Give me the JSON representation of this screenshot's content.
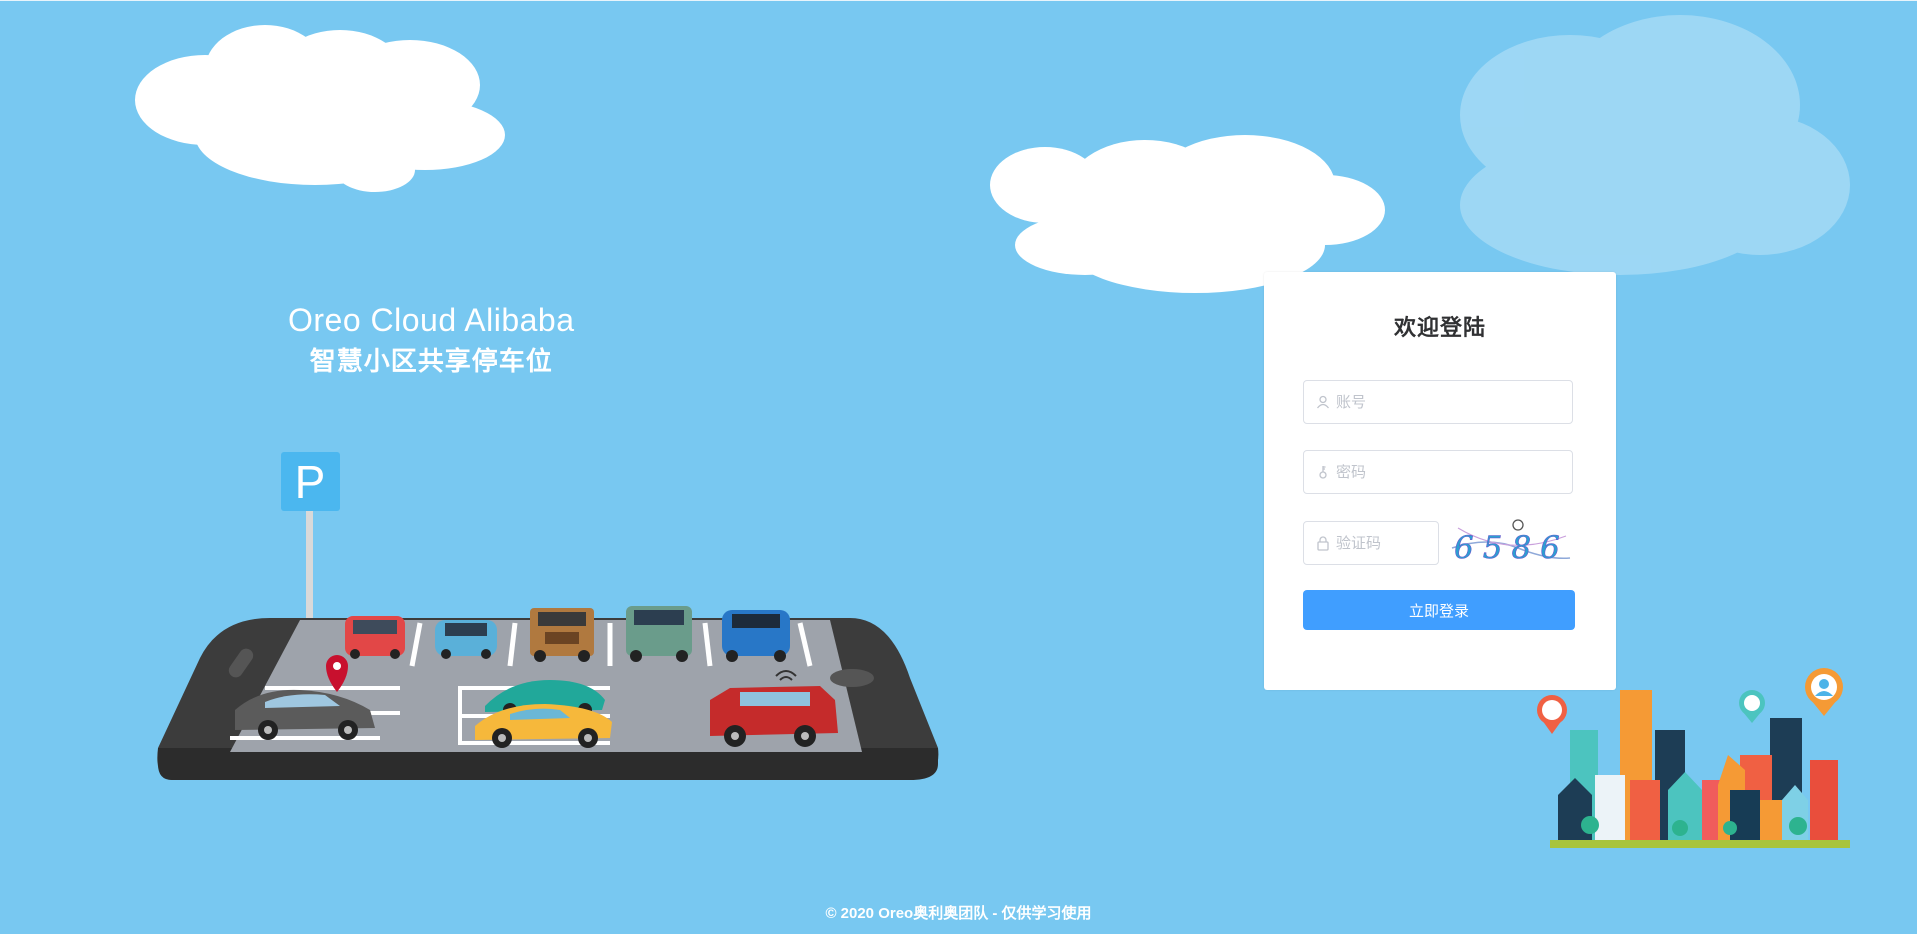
{
  "brand": {
    "title_en": "Oreo Cloud Alibaba",
    "title_cn": "智慧小区共享停车位"
  },
  "scene": {
    "parking_sign": "P"
  },
  "login": {
    "title": "欢迎登陆",
    "username_placeholder": "账号",
    "password_placeholder": "密码",
    "captcha_placeholder": "验证码",
    "captcha_code": "6586",
    "submit_label": "立即登录"
  },
  "footer": {
    "copyright": "© 2020 Oreo奥利奥团队 - 仅供学习使用"
  },
  "colors": {
    "background": "#78c8f1",
    "primary_button": "#409eff",
    "card": "#ffffff"
  }
}
